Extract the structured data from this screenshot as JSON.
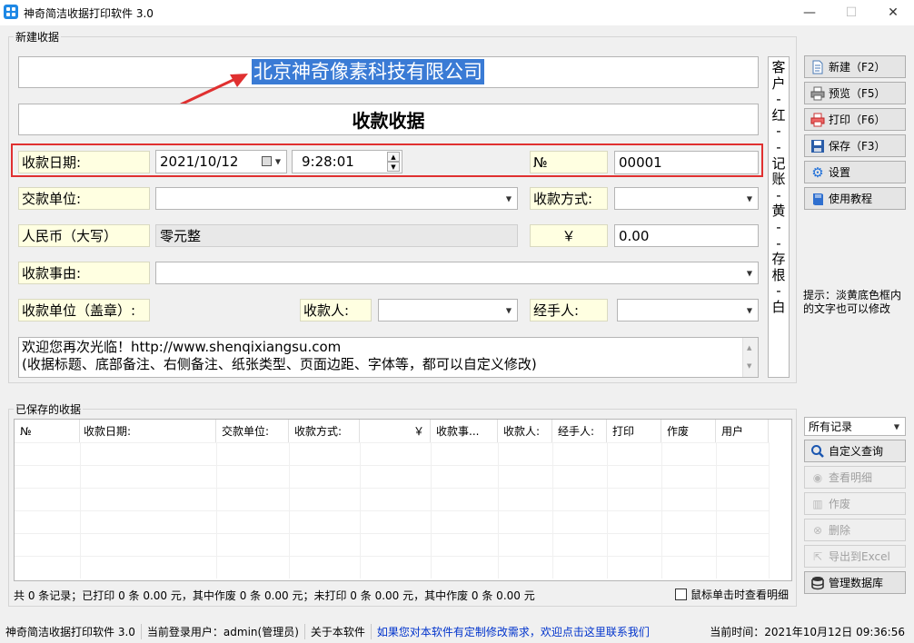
{
  "window": {
    "title": "神奇简洁收据打印软件 3.0",
    "controls": {
      "minimize": "—",
      "maximize": "☐",
      "close": "✕"
    }
  },
  "new_receipt": {
    "group_title": "新建收据",
    "company_name": "北京神奇像素科技有限公司",
    "receipt_title": "收款收据",
    "date_label": "收款日期:",
    "date_value": "2021/10/12",
    "time_value": "9:28:01",
    "no_label": "№",
    "no_value": "00001",
    "payer_label": "交款单位:",
    "payment_method_label": "收款方式:",
    "rmb_label": "人民币（大写）",
    "rmb_value": "零元整",
    "yen_label": "￥",
    "amount_value": "0.00",
    "reason_label": "收款事由:",
    "receiver_unit_label": "收款单位（盖章）:",
    "receiver_label": "收款人:",
    "handler_label": "经手人:",
    "note_line1": "欢迎您再次光临！http://www.shenqixiangsu.com",
    "note_line2": "(收据标题、底部备注、右侧备注、纸张类型、页面边距、字体等，都可以自定义修改)",
    "side_note_chars": [
      "客",
      "户",
      "-",
      "红",
      "-",
      "-",
      "记",
      "账",
      "-",
      "黄",
      "-",
      "-",
      "存",
      "根",
      "-",
      "白"
    ]
  },
  "toolbar": {
    "new_label": "新建（F2）",
    "preview_label": "预览（F5）",
    "print_label": "打印（F6）",
    "save_label": "保存（F3）",
    "settings_label": "设置",
    "tutorial_label": "使用教程",
    "hint": "提示：淡黄底色框内的文字也可以修改"
  },
  "saved": {
    "group_title": "已保存的收据",
    "columns": [
      "№",
      "收款日期:",
      "交款单位:",
      "收款方式:",
      "￥",
      "收款事...",
      "收款人:",
      "经手人:",
      "打印",
      "作废",
      "用户"
    ],
    "filter_value": "所有记录",
    "custom_query_label": "自定义查询",
    "view_detail_label": "查看明细",
    "void_label": "作废",
    "delete_label": "删除",
    "export_label": "导出到Excel",
    "manage_db_label": "管理数据库",
    "summary": "共 0 条记录；已打印 0 条 0.00 元，其中作废 0 条 0.00 元；未打印 0 条 0.00 元，其中作废 0 条 0.00 元",
    "click_view_label": "鼠标单击时查看明细"
  },
  "statusbar": {
    "app_name": "神奇简洁收据打印软件 3.0",
    "login_user": "当前登录用户：admin(管理员)",
    "about": "关于本软件",
    "custom_link": "如果您对本软件有定制修改需求，欢迎点击这里联系我们",
    "current_time": "当前时间：2021年10月12日 09:36:56"
  },
  "colors": {
    "selection": "#3a7bd5",
    "highlight_box": "#e03030",
    "arrow": "#e03030",
    "label_bg": "#ffffe1",
    "link": "#0033cc"
  },
  "icons": {
    "new": "document-icon",
    "preview": "printer-preview-icon",
    "print": "printer-icon",
    "save": "floppy-icon",
    "settings": "gear-icon",
    "tutorial": "book-icon",
    "query": "search-icon",
    "detail": "detail-icon",
    "void": "void-icon",
    "delete": "delete-icon",
    "export": "export-icon",
    "database": "database-icon"
  }
}
